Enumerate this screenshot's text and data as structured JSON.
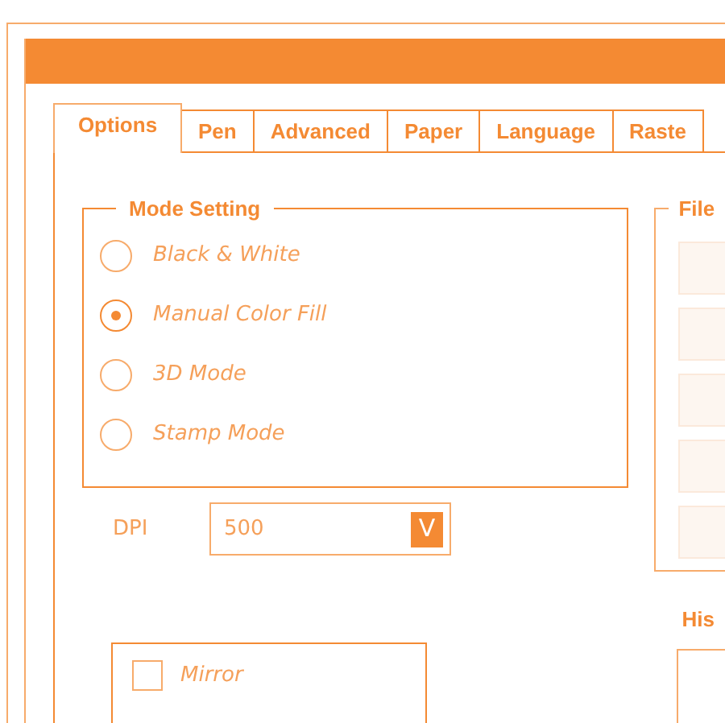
{
  "tabs": [
    {
      "label": "Options",
      "selected": true
    },
    {
      "label": "Pen",
      "selected": false
    },
    {
      "label": "Advanced",
      "selected": false
    },
    {
      "label": "Paper",
      "selected": false
    },
    {
      "label": "Language",
      "selected": false
    },
    {
      "label": "Raste",
      "selected": false
    }
  ],
  "mode_setting": {
    "legend": "Mode Setting",
    "options": [
      {
        "label": "Black & White",
        "selected": false
      },
      {
        "label": "Manual Color Fill",
        "selected": true
      },
      {
        "label": "3D Mode",
        "selected": false
      },
      {
        "label": "Stamp Mode",
        "selected": false
      }
    ]
  },
  "dpi": {
    "label": "DPI",
    "value": "500",
    "dropdown_button": "V"
  },
  "mirror": {
    "label": "Mirror",
    "checked": false
  },
  "file_group": {
    "legend": "File",
    "slots": [
      {
        "kind": "blank"
      },
      {
        "kind": "blank"
      },
      {
        "kind": "blank"
      },
      {
        "kind": "blank"
      },
      {
        "kind": "blank"
      }
    ]
  },
  "history": {
    "heading": "His"
  }
}
